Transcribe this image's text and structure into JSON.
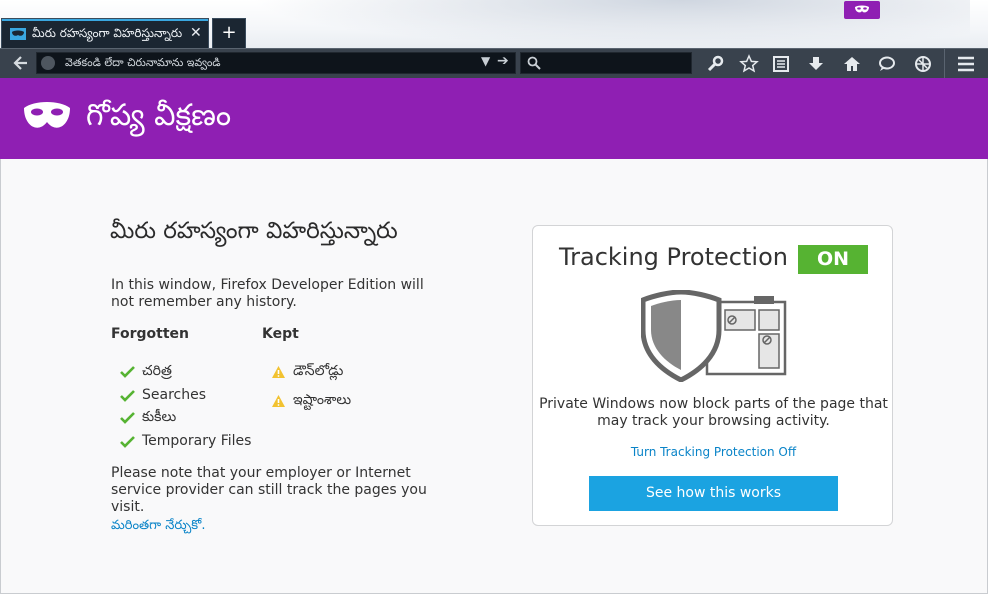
{
  "tab": {
    "title": "మీరు రహస్యంగా విహరిస్తున్నారు",
    "close_icon": "close-icon",
    "new_tab_label": "+"
  },
  "toolbar": {
    "url_placeholder": "వెతకండి లేదా చిరునామాను ఇవ్వండి",
    "search_placeholder": "",
    "icons": [
      "back-arrow-icon",
      "wrench-icon",
      "star-icon",
      "reading-list-icon",
      "download-icon",
      "home-icon",
      "chat-icon",
      "developer-icon",
      "menu-icon"
    ]
  },
  "header": {
    "title": "గోప్య వీక్షణం"
  },
  "left": {
    "heading": "మీరు రహస్యంగా విహరిస్తున్నారు",
    "intro": "In this window, Firefox Developer Edition will not remember any history.",
    "forgotten_label": "Forgotten",
    "kept_label": "Kept",
    "forgotten_items": [
      "చరిత్ర",
      "Searches",
      "కుకీలు",
      "Temporary Files"
    ],
    "kept_items": [
      "డౌన్‌లోడ్లు",
      "ఇష్టాంశాలు"
    ],
    "note": "Please note that your employer or Internet service provider can still track the pages you visit.",
    "learn_more": "మరింతగా నేర్చుకో."
  },
  "tracking": {
    "title": "Tracking Protection",
    "status": "ON",
    "description": "Private Windows now block parts of the page that may track your browsing activity.",
    "turn_off": "Turn Tracking Protection Off",
    "button": "See how this works"
  },
  "colors": {
    "purple": "#8f1fb3",
    "green": "#56b332",
    "blue": "#1ba3e1",
    "link": "#0a84c8"
  }
}
